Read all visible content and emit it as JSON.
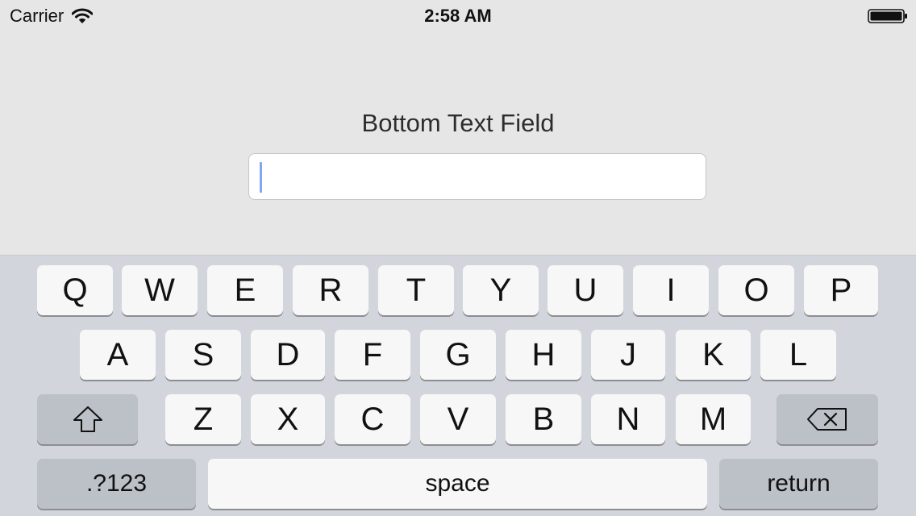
{
  "status_bar": {
    "carrier": "Carrier",
    "time": "2:58 AM",
    "wifi_icon": "wifi-icon",
    "battery_icon": "battery-full-icon"
  },
  "form": {
    "label": "Bottom Text Field",
    "field": {
      "value": "",
      "placeholder": "",
      "focused": true
    }
  },
  "keyboard": {
    "row1": [
      "Q",
      "W",
      "E",
      "R",
      "T",
      "Y",
      "U",
      "I",
      "O",
      "P"
    ],
    "row2": [
      "A",
      "S",
      "D",
      "F",
      "G",
      "H",
      "J",
      "K",
      "L"
    ],
    "row3": [
      "Z",
      "X",
      "C",
      "V",
      "B",
      "N",
      "M"
    ],
    "shift_icon": "shift-arrow-icon",
    "delete_icon": "delete-backspace-icon",
    "numbers_label": ".?123",
    "space_label": "space",
    "return_label": "return"
  },
  "colors": {
    "background": "#e6e6e7",
    "keyboard_background": "#d2d5db",
    "key_light": "#f7f7f7",
    "key_dark": "#bcc0c7",
    "caret": "#7ea6f5"
  }
}
